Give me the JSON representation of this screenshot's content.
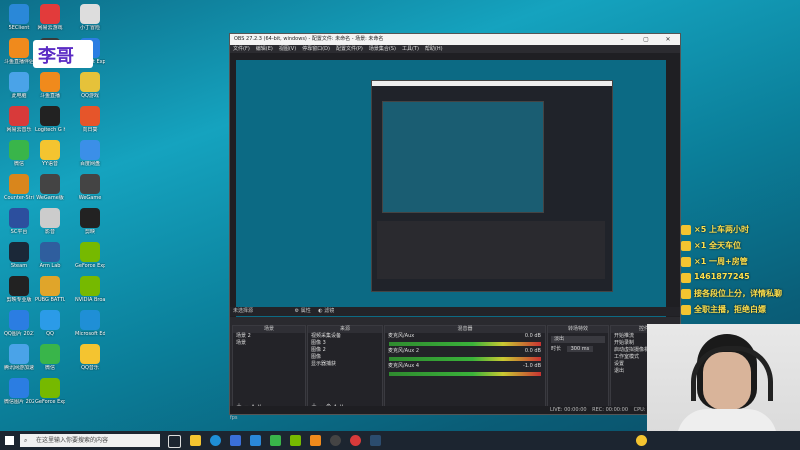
{
  "desktop": {
    "icons": [
      {
        "label": "5EClient",
        "color": "#2a88d8"
      },
      {
        "label": "网易云游戏",
        "color": "#e23b3b"
      },
      {
        "label": "小丁冒险",
        "color": "#dddddd"
      },
      {
        "label": "斗鱼直播伴侣",
        "color": "#f08a1c"
      },
      {
        "label": "WeGame",
        "color": "#3a3a3a"
      },
      {
        "label": "Internet Explorer",
        "color": "#2b7de2"
      },
      {
        "label": "此电脑",
        "color": "#4aa3e8"
      },
      {
        "label": "斗鱼直播",
        "color": "#f08a1c"
      },
      {
        "label": "QQ游戏",
        "color": "#e6c23a"
      },
      {
        "label": "网易云音乐",
        "color": "#d83a3a"
      },
      {
        "label": "Logitech G HUB",
        "color": "#222222"
      },
      {
        "label": "向日葵",
        "color": "#e6552a"
      },
      {
        "label": "微信",
        "color": "#39b54a"
      },
      {
        "label": "YY语音",
        "color": "#f4c430"
      },
      {
        "label": "百度网盘",
        "color": "#3b8fe8"
      },
      {
        "label": "Counter-Strike Global Off...",
        "color": "#d9861c"
      },
      {
        "label": "WeGame版",
        "color": "#444444"
      },
      {
        "label": "WeGame",
        "color": "#444444"
      },
      {
        "label": "SC平台",
        "color": "#2c4f9e"
      },
      {
        "label": "影音",
        "color": "#cccccc"
      },
      {
        "label": "剪映",
        "color": "#222222"
      },
      {
        "label": "Steam",
        "color": "#1b2838"
      },
      {
        "label": "Arm Lab",
        "color": "#2f5e9e"
      },
      {
        "label": "GeForce Experience",
        "color": "#76b900"
      },
      {
        "label": "剪映专业版",
        "color": "#222222"
      },
      {
        "label": "PUBG BATTLEGR...",
        "color": "#e0a52a"
      },
      {
        "label": "NVIDIA Broadcast",
        "color": "#76b900"
      },
      {
        "label": "QQ图片 20216031...",
        "color": "#2b7de2"
      },
      {
        "label": "QQ",
        "color": "#2b9be8"
      },
      {
        "label": "Microsoft Edge",
        "color": "#1f8fd6"
      },
      {
        "label": "腾讯网游加速器",
        "color": "#4aa3e8"
      },
      {
        "label": "微信",
        "color": "#39b54a"
      },
      {
        "label": "QQ音乐",
        "color": "#f4c430"
      },
      {
        "label": "微信图片 20210602...",
        "color": "#2b7de2"
      },
      {
        "label": "GeForce Experience",
        "color": "#76b900"
      }
    ],
    "watermark": "李哥"
  },
  "obs": {
    "title": "OBS 27.2.3 (64-bit, windows) - 配置文件: 未命名 - 场景: 未命名",
    "menu": [
      "文件(F)",
      "编辑(E)",
      "视图(V)",
      "停靠窗口(D)",
      "配置文件(P)",
      "场景集合(S)",
      "工具(T)",
      "帮助(H)"
    ],
    "no_source_selected": "未选择源",
    "properties_button": "属性",
    "filters_button": "滤镜",
    "docks": {
      "scenes": {
        "header": "场景",
        "items": [
          "场景 2",
          "场景"
        ]
      },
      "sources": {
        "header": "来源",
        "items": [
          "视频采集设备",
          "图像 3",
          "图像 2",
          "图像",
          "显示器捕获"
        ]
      },
      "mixer": {
        "header": "混音器",
        "channels": [
          {
            "name": "麦克风/Aux",
            "level": "0.0 dB"
          },
          {
            "name": "麦克风/Aux 2",
            "level": "0.0 dB"
          },
          {
            "name": "麦克风/Aux 4",
            "level": "-1.0 dB"
          }
        ]
      },
      "transitions": {
        "header": "转场特效",
        "type": "淡出",
        "duration_label": "时长",
        "duration": "300 ms"
      },
      "controls": {
        "header": "控件",
        "buttons": [
          "开始推流",
          "开始录制",
          "启动虚拟摄像机",
          "工作室模式",
          "设置",
          "退出"
        ]
      }
    },
    "status": {
      "live": "LIVE: 00:00:00",
      "rec": "REC: 00:00:00",
      "cpu": "CPU: 0.1%, 60.00 fps"
    }
  },
  "taskbar": {
    "search_placeholder": "在这里输入你要搜索的内容"
  },
  "stream_overlay": {
    "lines": [
      {
        "text": "×5  上车两小时",
        "color": "#f4c430"
      },
      {
        "text": "×1  全天车位",
        "color": "#f4c430"
      },
      {
        "text": "×1  一周+房管",
        "color": "#f4c430"
      },
      {
        "text": "1461877245",
        "color": "#f4c430"
      },
      {
        "text": "接各段位上分，详情私聊",
        "color": "#f4c430"
      },
      {
        "text": "全职主播，拒绝白嫖",
        "color": "#f4c430"
      }
    ]
  }
}
